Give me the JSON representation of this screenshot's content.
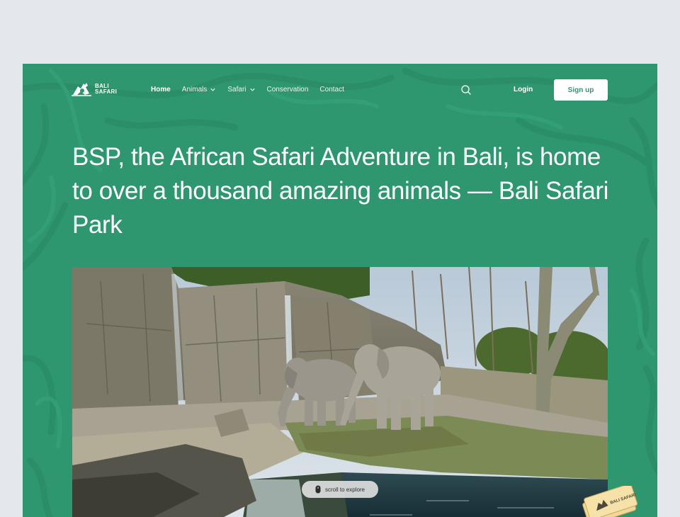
{
  "brand": {
    "line1": "BALI",
    "line2": "SAFARI"
  },
  "nav": {
    "items": [
      {
        "label": "Home",
        "active": true,
        "dropdown": false
      },
      {
        "label": "Animals",
        "active": false,
        "dropdown": true
      },
      {
        "label": "Safari",
        "active": false,
        "dropdown": true
      },
      {
        "label": "Conservation",
        "active": false,
        "dropdown": false
      },
      {
        "label": "Contact",
        "active": false,
        "dropdown": false
      }
    ],
    "search_icon": "search-icon",
    "login_label": "Login",
    "signup_label": "Sign up"
  },
  "hero": {
    "headline": "BSP, the African Safari Adventure in Bali, is home to over a thousand amazing animals — Bali Safari Park",
    "image_subject": "elephants-enclosure",
    "scroll_label": "scroll to explore"
  },
  "ticket": {
    "label": "BALI SAFARI"
  },
  "colors": {
    "brand_green": "#2f9770",
    "page_bg": "#e4e7ec",
    "text_on_brand": "#ffffff"
  }
}
